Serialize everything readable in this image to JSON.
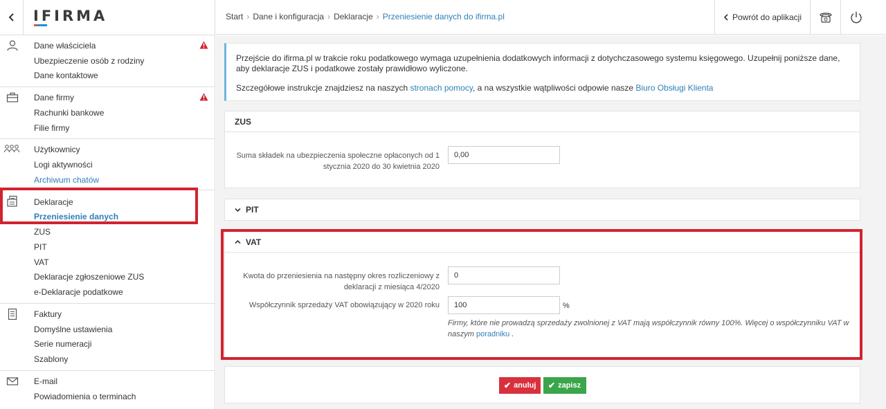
{
  "app": {
    "logo": "IFIRMA"
  },
  "sidebar": {
    "collapse_icon": "chevron-left-icon",
    "groups": [
      {
        "icon": "user-icon",
        "items": [
          {
            "label": "Dane właściciela",
            "warning": true
          },
          {
            "label": "Ubezpieczenie osób z rodziny"
          },
          {
            "label": "Dane kontaktowe"
          }
        ]
      },
      {
        "icon": "briefcase-icon",
        "items": [
          {
            "label": "Dane firmy",
            "warning": true
          },
          {
            "label": "Rachunki bankowe"
          },
          {
            "label": "Filie firmy"
          }
        ]
      },
      {
        "icon": "users-icon",
        "items": [
          {
            "label": "Użytkownicy"
          },
          {
            "label": "Logi aktywności"
          },
          {
            "label": "Archiwum chatów",
            "link": true
          }
        ]
      },
      {
        "icon": "declaration-icon",
        "items": [
          {
            "label": "Deklaracje"
          },
          {
            "label": "Przeniesienie danych",
            "active": true
          },
          {
            "label": "ZUS"
          },
          {
            "label": "PIT"
          },
          {
            "label": "VAT"
          },
          {
            "label": "Deklaracje zgłoszeniowe ZUS"
          },
          {
            "label": "e-Deklaracje podatkowe"
          }
        ]
      },
      {
        "icon": "invoice-icon",
        "items": [
          {
            "label": "Faktury"
          },
          {
            "label": "Domyślne ustawienia"
          },
          {
            "label": "Serie numeracji"
          },
          {
            "label": "Szablony"
          }
        ]
      },
      {
        "icon": "envelope-icon",
        "items": [
          {
            "label": "E-mail"
          },
          {
            "label": "Powiadomienia o terminach"
          }
        ]
      }
    ]
  },
  "topbar": {
    "breadcrumb": [
      "Start",
      "Dane i konfiguracja",
      "Deklaracje",
      "Przeniesienie danych do ifirma.pl"
    ],
    "back_label": "Powrót do aplikacji",
    "phone_icon": "phone-icon",
    "power_icon": "power-icon"
  },
  "info": {
    "line1": "Przejście do ifirma.pl w trakcie roku podatkowego wymaga uzupełnienia dodatkowych informacji z dotychczasowego systemu księgowego. Uzupełnij poniższe dane, aby deklaracje ZUS i podatkowe zostały prawidłowo wyliczone.",
    "line2_prefix": "Szczegółowe instrukcje znajdziesz na naszych ",
    "line2_link1": "stronach pomocy",
    "line2_middle": ", a na wszystkie wątpliwości odpowie nasze ",
    "line2_link2": "Biuro Obsługi Klienta"
  },
  "zus": {
    "title": "ZUS",
    "label_line1": "Suma składek na ubezpieczenia społeczne opłaconych od 1",
    "label_line2": "stycznia 2020 do 30 kwietnia 2020",
    "value": "0,00"
  },
  "pit": {
    "title": "PIT"
  },
  "vat": {
    "title": "VAT",
    "transfer_label_line1": "Kwota do przeniesienia na następny okres rozliczeniowy z",
    "transfer_label_line2": "deklaracji z miesiąca 4/2020",
    "transfer_value": "0",
    "ratio_label": "Współczynnik sprzedaży VAT obowiązujący w 2020 roku",
    "ratio_value": "100",
    "ratio_unit": "%",
    "hint_line1": "Firmy, które nie prowadzą sprzedaży zwolnionej z VAT mają współczynnik równy 100%. Więcej o współczynniku VAT w",
    "hint_line2_prefix": "naszym ",
    "hint_link": "poradniku",
    "hint_suffix": " ."
  },
  "actions": {
    "cancel_label": "anuluj",
    "save_label": "zapisz"
  },
  "colors": {
    "highlight": "#d2232f",
    "link": "#2f7fb8",
    "cancel": "#d9303e",
    "save": "#3aa54a"
  }
}
